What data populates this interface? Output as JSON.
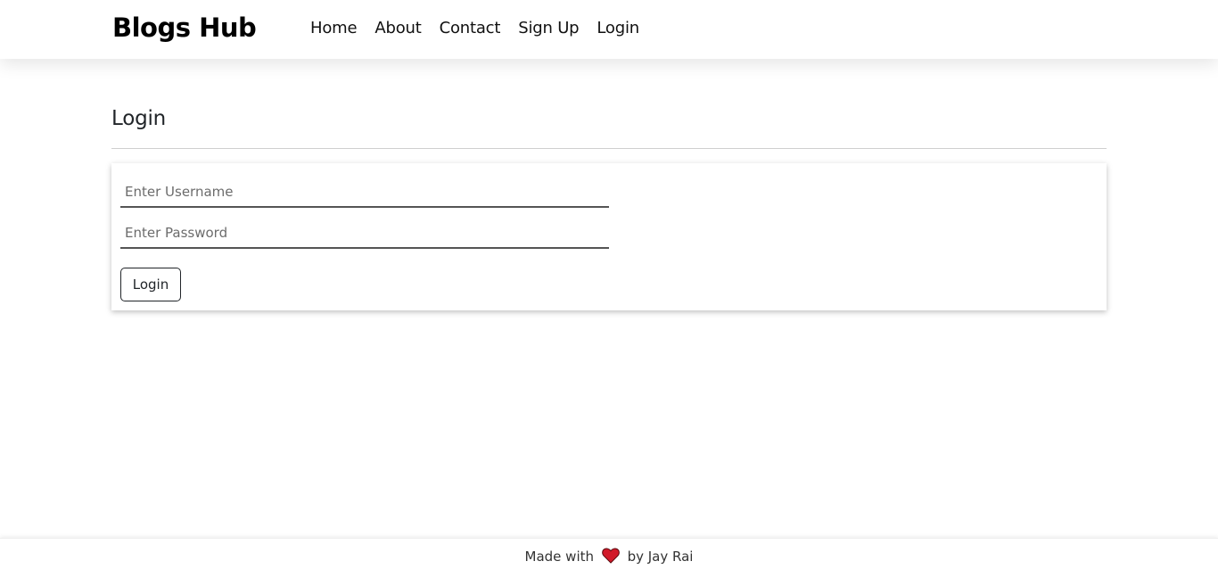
{
  "navbar": {
    "brand": "Blogs Hub",
    "links": [
      {
        "label": "Home"
      },
      {
        "label": "About"
      },
      {
        "label": "Contact"
      },
      {
        "label": "Sign Up"
      },
      {
        "label": "Login"
      }
    ]
  },
  "main": {
    "title": "Login",
    "form": {
      "username_placeholder": "Enter Username",
      "username_value": "",
      "password_placeholder": "Enter Password",
      "password_value": "",
      "submit_label": "Login"
    }
  },
  "footer": {
    "text_before": "Made with",
    "icon": "heart-icon",
    "text_after": "by Jay Rai"
  },
  "colors": {
    "heart": "#d11a2a",
    "text": "#212529",
    "brand": "#000000"
  }
}
